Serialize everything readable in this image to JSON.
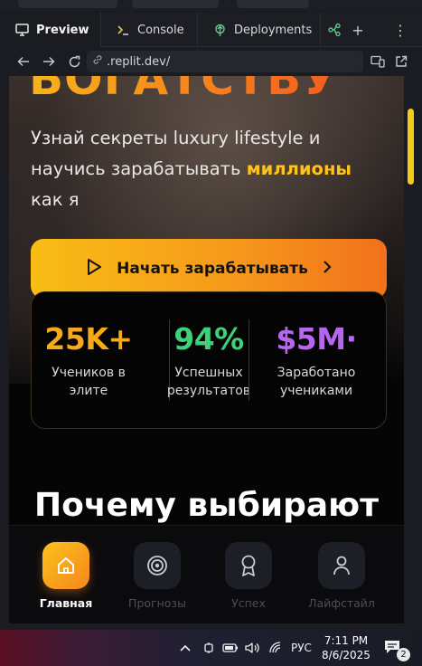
{
  "tabs": [
    {
      "label": "Preview",
      "icon": "monitor-icon"
    },
    {
      "label": "Console",
      "icon": "terminal-icon"
    },
    {
      "label": "Deployments",
      "icon": "deploy-icon"
    }
  ],
  "urlbar": {
    "url": ".replit.dev/"
  },
  "hero": {
    "title": "БОГАТСТВУ",
    "sub_before": "Узнай секреты luxury lifestyle и научись зарабатывать ",
    "sub_accent": "миллионы",
    "sub_after": " как я"
  },
  "cta": {
    "label": "Начать зарабатывать"
  },
  "stats": [
    {
      "value": "25K+",
      "label_line1": "Учеников в",
      "label_line2": "элите",
      "color": "#f7a91c"
    },
    {
      "value": "94%",
      "label_line1": "Успешных",
      "label_line2": "результатов",
      "color": "#3ed17a"
    },
    {
      "value": "$5M·",
      "label_line1": "Заработано",
      "label_line2": "учениками",
      "color": "#b865f0"
    }
  ],
  "section": {
    "title": "Почему выбирают"
  },
  "bottom_nav": [
    {
      "label": "Главная",
      "icon": "home-icon",
      "active": true
    },
    {
      "label": "Прогнозы",
      "icon": "target-icon",
      "active": false
    },
    {
      "label": "Успех",
      "icon": "award-icon",
      "active": false
    },
    {
      "label": "Лайфстайл",
      "icon": "user-icon",
      "active": false
    }
  ],
  "taskbar": {
    "language": "РУС",
    "time": "7:11 PM",
    "date": "8/6/2025",
    "notifications": "2"
  },
  "colors": {
    "accent_yellow": "#ffc21a",
    "accent_orange": "#f2711c",
    "scroll_thumb": "#f4cc18"
  }
}
